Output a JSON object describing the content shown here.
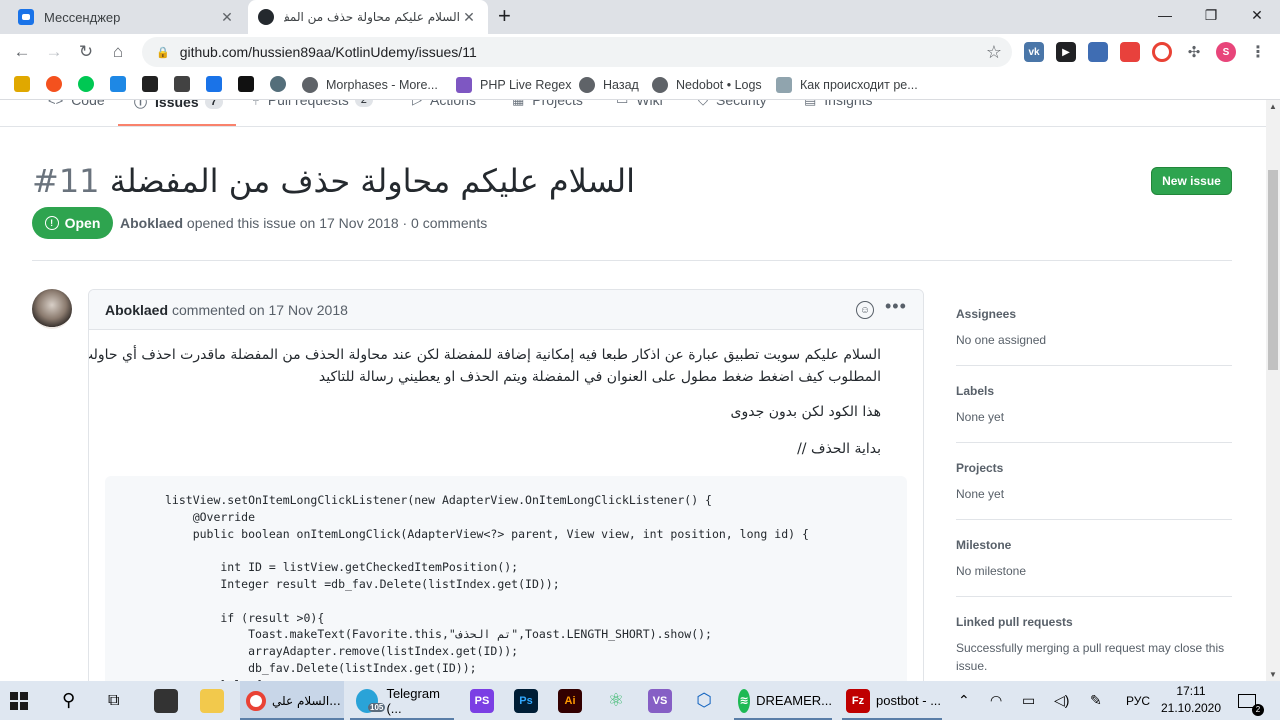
{
  "browser": {
    "tabs": [
      {
        "title": "Мессенджер"
      },
      {
        "title": "السلام عليكم محاولة حذف من المف"
      }
    ],
    "new_tab_symbol": "+",
    "address": "github.com/hussien89aa/KotlinUdemy/issues/11"
  },
  "bookmarks": [
    {
      "label": "Morphases - More..."
    },
    {
      "label": "PHP Live Regex"
    },
    {
      "label": "Назад"
    },
    {
      "label": "Nedobot • Logs"
    },
    {
      "label": "Как происходит ре..."
    }
  ],
  "repo_nav": [
    {
      "label": "Code"
    },
    {
      "label": "Issues",
      "count": "7"
    },
    {
      "label": "Pull requests",
      "count": "2"
    },
    {
      "label": "Actions"
    },
    {
      "label": "Projects"
    },
    {
      "label": "Wiki"
    },
    {
      "label": "Security"
    },
    {
      "label": "Insights"
    }
  ],
  "issue": {
    "title": "السلام عليكم محاولة حذف من المفضلة",
    "number": "#11",
    "state": "Open",
    "new_issue_label": "New issue",
    "author": "Aboklaed",
    "meta_text": "opened this issue on 17 Nov 2018 · 0 comments"
  },
  "comment": {
    "author": "Aboklaed",
    "meta": "commented on 17 Nov 2018",
    "paragraph1_line1": "السلام عليكم سويت تطبيق عبارة عن اذكار طبعا فيه إمكانية إضافة للمفضلة لكن عند محاولة الحذف من المفضلة ماقدرت احذف أي حاولت",
    "paragraph1_line2": "المطلوب كيف اضغط ضغط مطول على العنوان في المفضلة ويتم الحذف او يعطيني رسالة للتاكيد",
    "paragraph2": "هذا الكود لكن بدون جدوى",
    "paragraph3": "بداية الحذف //",
    "code": "listView.setOnItemLongClickListener(new AdapterView.OnItemLongClickListener() {\n    @Override\n    public boolean onItemLongClick(AdapterView<?> parent, View view, int position, long id) {\n\n        int ID = listView.getCheckedItemPosition();\n        Integer result =db_fav.Delete(listIndex.get(ID));\n\n        if (result >0){\n            Toast.makeText(Favorite.this,\"تم الحذف\",Toast.LENGTH_SHORT).show();\n            arrayAdapter.remove(listIndex.get(ID));\n            db_fav.Delete(listIndex.get(ID));\n        }else{"
  },
  "sidebar": {
    "assignees_label": "Assignees",
    "assignees_value": "No one assigned",
    "labels_label": "Labels",
    "labels_value": "None yet",
    "projects_label": "Projects",
    "projects_value": "None yet",
    "milestone_label": "Milestone",
    "milestone_value": "No milestone",
    "linked_label": "Linked pull requests",
    "linked_value": "Successfully merging a pull request may close this issue."
  },
  "taskbar": {
    "items": [
      {
        "label": "السلام علي..."
      },
      {
        "label": "Telegram (..."
      },
      {
        "label": "DREAMER..."
      },
      {
        "label": "postbot - ..."
      }
    ],
    "telegram_badge": "105",
    "lang": "РУС",
    "time": "17:11",
    "date": "21.10.2020",
    "notification_count": "2"
  },
  "colors": {
    "open_green": "#2ea44f",
    "link_gray": "#586069",
    "active_tab_underline": "#f9826c"
  }
}
